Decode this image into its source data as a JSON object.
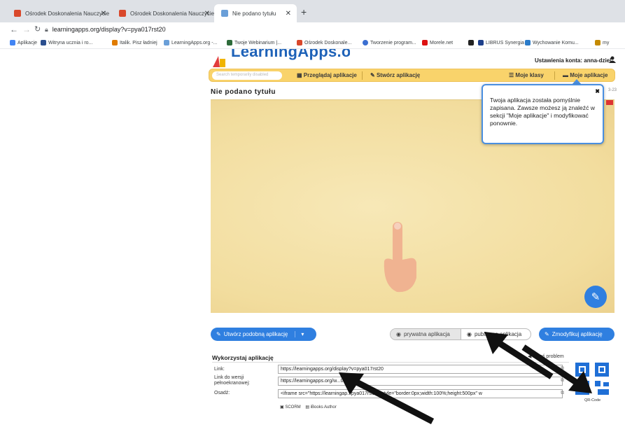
{
  "browser": {
    "tabs": [
      {
        "title": "Ośrodek Doskonalenia Nauczycie",
        "favicon_color": "#d9482b"
      },
      {
        "title": "Ośrodek Doskonalenia Nauczycie",
        "favicon_color": "#d9482b"
      },
      {
        "title": "Nie podano tytułu",
        "favicon_color": "#6a9fd8"
      }
    ],
    "new_tab": "+",
    "url": "learningapps.org/display?v=pya017rst20",
    "bookmarks": [
      {
        "label": "Aplikacje",
        "color": "#4285f4"
      },
      {
        "label": "Witryna ucznia i ro...",
        "color": "#2b4f8f"
      },
      {
        "label": "Italik. Pisz ładniej",
        "color": "#e07b00"
      },
      {
        "label": "LearningApps.org -...",
        "color": "#6a9fd8"
      },
      {
        "label": "Twoje Webinarium |...",
        "color": "#2d6b3a"
      },
      {
        "label": "Ośrodek Doskonale...",
        "color": "#d9482b"
      },
      {
        "label": "Tworzenie program...",
        "color": "#3b6fd1"
      },
      {
        "label": "Morele.net",
        "color": "#d11"
      },
      {
        "label": "",
        "color": "#222"
      },
      {
        "label": "LIBRUS Synergia",
        "color": "#1d3f8a"
      },
      {
        "label": "Wychowanie Komu...",
        "color": "#2a7bc9"
      },
      {
        "label": "my",
        "color": "#c48a00"
      }
    ]
  },
  "site": {
    "logo": "LearningApps.org",
    "account": "Ustawienia konta: anna-dziel",
    "search_placeholder": "Search temporarily disabled",
    "nav": {
      "browse": "Przeglądaj aplikacje",
      "create": "Stwórz aplikację",
      "classes": "Moje klasy",
      "my_apps": "Moje aplikacje"
    },
    "page_title": "Nie podano tytułu",
    "date_fragment": "3-23",
    "popup_text": "Twoja aplikacja została pomyślnie zapisana. Zawsze możesz ją znaleźć w sekcji \"Moje aplikacje\" i modyfikować ponownie.",
    "popup_close": "✖",
    "buttons": {
      "similar": "Utwórz podobną aplikację",
      "private": "prywatna aplikacja",
      "public": "publiczna aplikacja",
      "modify": "Zmodyfikuj aplikację"
    },
    "use_section": {
      "title": "Wykorzystaj aplikację",
      "report": "Zgłoś problem",
      "link_label": "Link:",
      "link_value": "https://learningapps.org/display?v=pya017rst20",
      "fullscreen_label": "Link do wersji pełnoekranowej:",
      "fullscreen_value": "https://learningapps.org/w...017rst20",
      "embed_label": "Osadź:",
      "embed_value": "<iframe src=\"https://learningap...pya017rst20\" style=\"border:0px;width:100%;height:500px\" w",
      "scorm": "SCORM",
      "ibooks": "iBooks Author",
      "qr_label": "QR-Code"
    }
  }
}
